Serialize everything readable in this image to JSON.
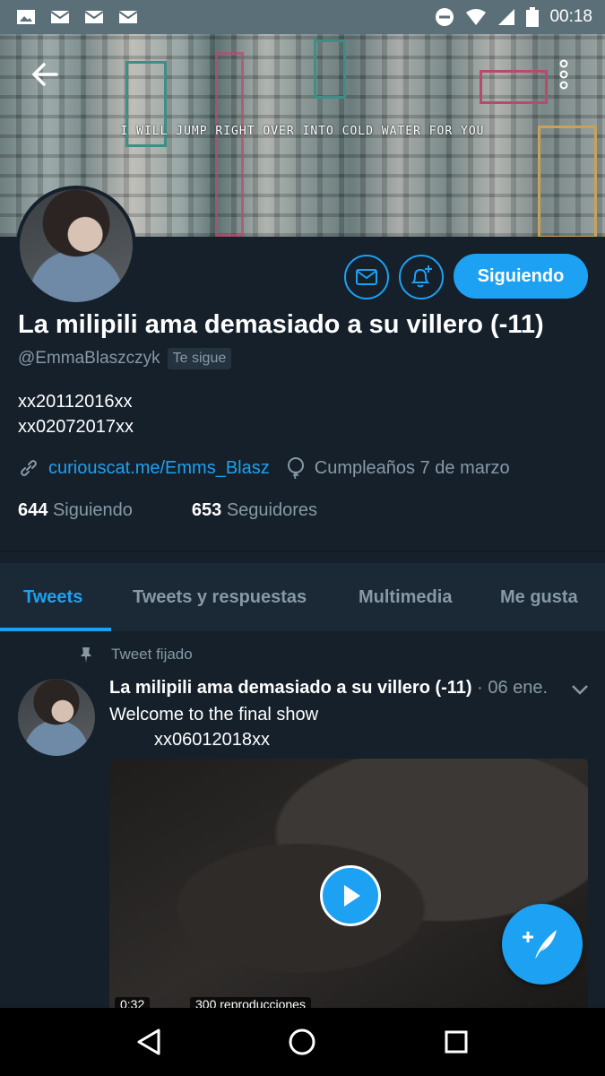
{
  "status_bar": {
    "time": "00:18",
    "left_icons": [
      "image-icon",
      "mail-icon",
      "mail-icon",
      "mail-icon"
    ],
    "right_icons": [
      "do-not-disturb-icon",
      "wifi-icon",
      "signal-icon",
      "battery-icon"
    ]
  },
  "header": {
    "quote": "I WILL JUMP RIGHT OVER INTO COLD WATER FOR YOU",
    "back_icon": "arrow-left-icon",
    "more_icon": "more-vertical-icon"
  },
  "profile": {
    "name": "La milipili ama demasiado a su villero (-11)",
    "handle": "@EmmaBlaszczyk",
    "follows_you": "Te sigue",
    "bio_lines": [
      "xx20112016xx",
      "xx02072017xx"
    ],
    "link": "curiouscat.me/Emms_Blasz",
    "birthday": "Cumpleaños 7 de marzo",
    "following_count": "644",
    "following_label": "Siguiendo",
    "followers_count": "653",
    "followers_label": "Seguidores",
    "follow_button": "Siguiendo"
  },
  "tabs": [
    {
      "label": "Tweets",
      "active": true
    },
    {
      "label": "Tweets y respuestas",
      "active": false
    },
    {
      "label": "Multimedia",
      "active": false
    },
    {
      "label": "Me gusta",
      "active": false
    }
  ],
  "tweet": {
    "pinned_label": "Tweet fijado",
    "author": "La milipili ama demasiado a su villero (-11)",
    "date": "· 06 ene.",
    "text": "Welcome to the final show\n         xx06012018xx",
    "video_duration": "0:32",
    "video_views": "300 reproducciones"
  },
  "colors": {
    "background": "#15202b",
    "accent": "#1da1f2",
    "muted": "#8899a6"
  }
}
